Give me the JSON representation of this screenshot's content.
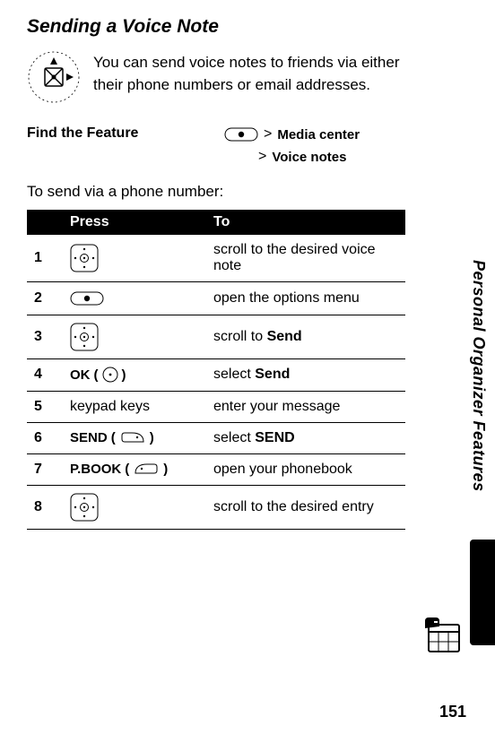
{
  "title": "Sending a Voice Note",
  "intro": "You can send voice notes to friends via either their phone numbers or email addresses.",
  "feature_label": "Find the Feature",
  "feature_path1": "Media center",
  "feature_path2": "Voice notes",
  "gt": ">",
  "subhead": "To send via a phone number:",
  "thead": {
    "c1": "",
    "c2": "Press",
    "c3": "To"
  },
  "keypad_label": "keypad keys",
  "ok_label": "OK",
  "send_label": "SEND",
  "pbook_label": "P.BOOK",
  "open_paren": "(",
  "close_paren": ")",
  "rows": [
    {
      "n": "1",
      "to_pre": "scroll to the desired voice note"
    },
    {
      "n": "2",
      "to_pre": "open the options menu"
    },
    {
      "n": "3",
      "to_pre": "scroll to ",
      "bold": "Send"
    },
    {
      "n": "4",
      "to_pre": "select ",
      "bold": "Send"
    },
    {
      "n": "5",
      "to_pre": "enter your message"
    },
    {
      "n": "6",
      "to_pre": "select ",
      "bold": "SEND"
    },
    {
      "n": "7",
      "to_pre": "open your phonebook"
    },
    {
      "n": "8",
      "to_pre": "scroll to the desired entry"
    }
  ],
  "side": "Personal Organizer Features",
  "pagenum": "151"
}
